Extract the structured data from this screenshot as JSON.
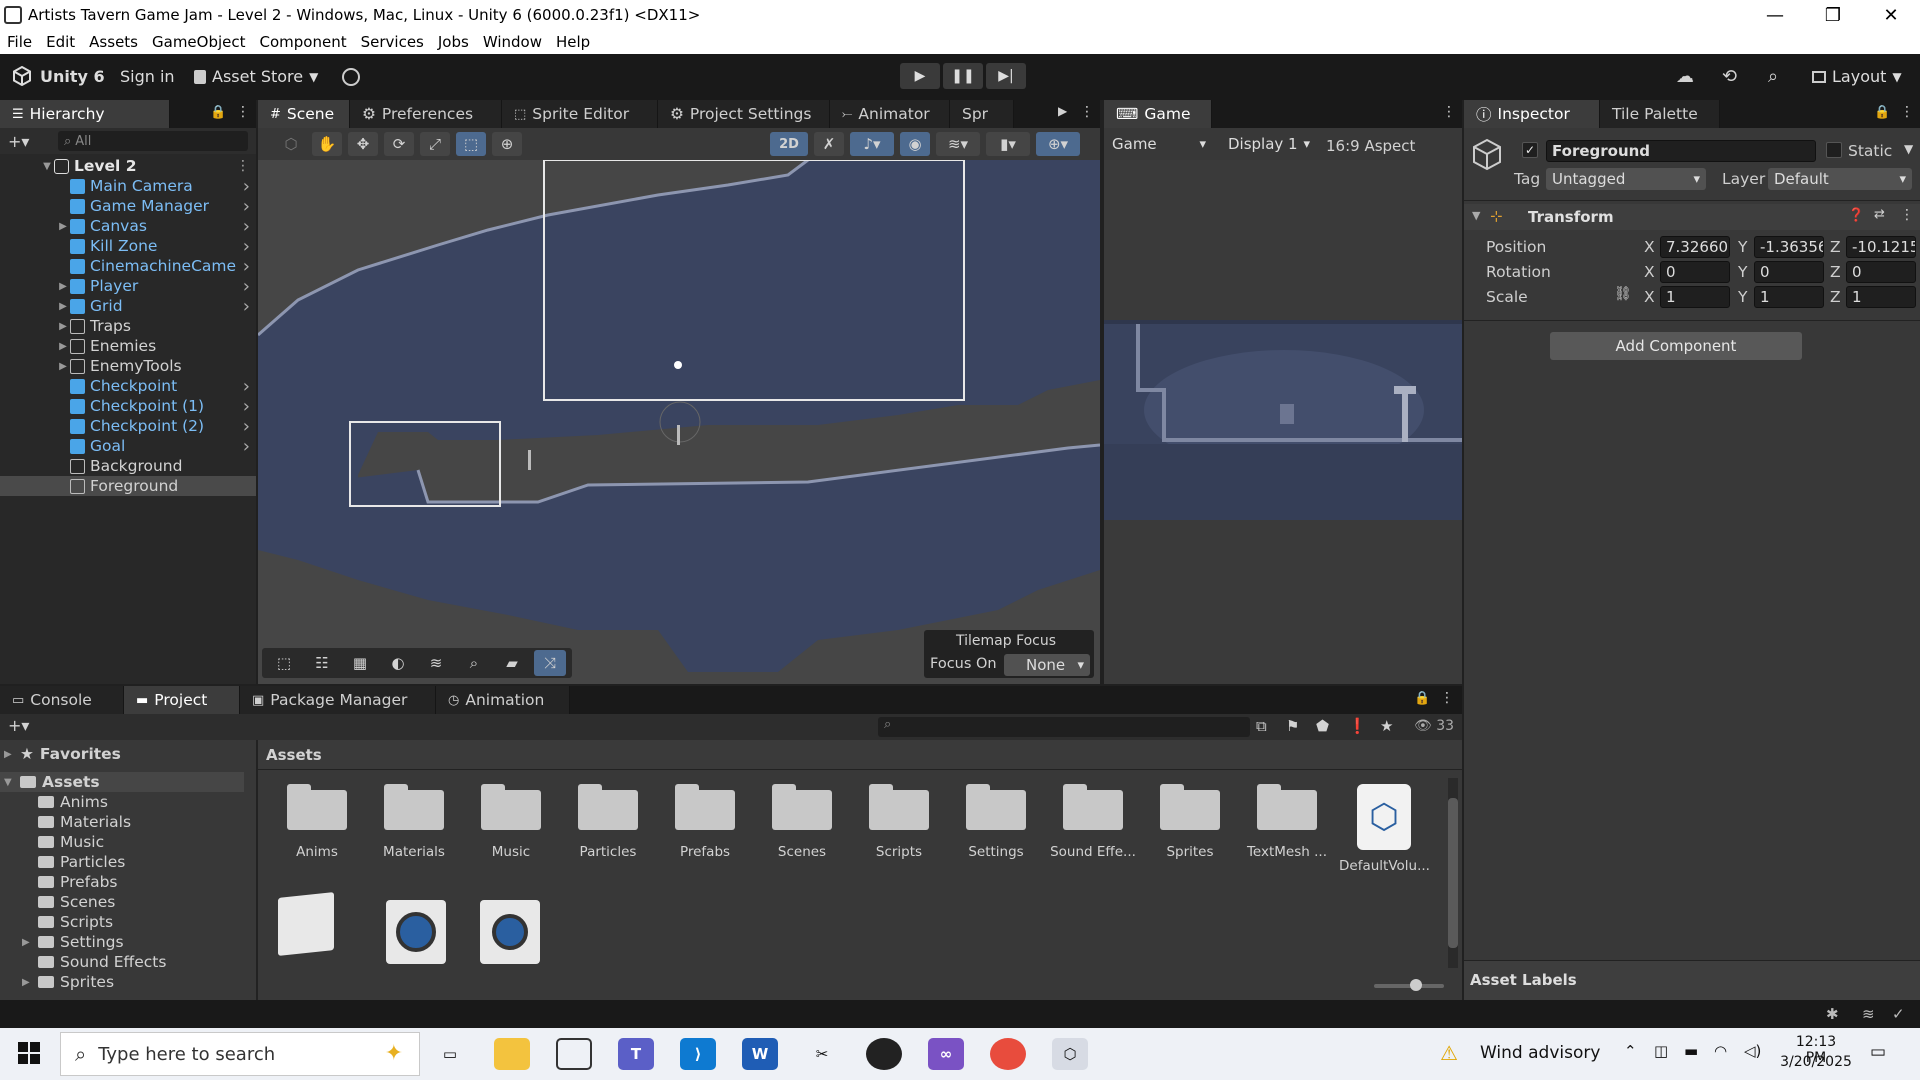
{
  "window": {
    "title": "Artists Tavern Game Jam - Level 2 - Windows, Mac, Linux - Unity 6 (6000.0.23f1) <DX11>",
    "minimize": "—",
    "maximize": "❐",
    "close": "✕"
  },
  "menu": [
    "File",
    "Edit",
    "Assets",
    "GameObject",
    "Component",
    "Services",
    "Jobs",
    "Window",
    "Help"
  ],
  "toolbar": {
    "unity_label": "Unity 6",
    "sign_in": "Sign in",
    "asset_store": "Asset Store",
    "layout": "Layout"
  },
  "hierarchy": {
    "tab": "Hierarchy",
    "search_placeholder": "All",
    "scene": "Level 2",
    "items": [
      {
        "name": "Main Camera",
        "blue": true,
        "expand": false
      },
      {
        "name": "Game Manager",
        "blue": true,
        "expand": false
      },
      {
        "name": "Canvas",
        "blue": true,
        "expand": true
      },
      {
        "name": "Kill Zone",
        "blue": true,
        "expand": false
      },
      {
        "name": "CinemachineCame",
        "blue": true,
        "expand": false
      },
      {
        "name": "Player",
        "blue": true,
        "expand": true
      },
      {
        "name": "Grid",
        "blue": true,
        "expand": true
      },
      {
        "name": "Traps",
        "blue": false,
        "expand": true
      },
      {
        "name": "Enemies",
        "blue": false,
        "expand": true
      },
      {
        "name": "EnemyTools",
        "blue": false,
        "expand": true
      },
      {
        "name": "Checkpoint",
        "blue": true,
        "expand": false
      },
      {
        "name": "Checkpoint (1)",
        "blue": true,
        "expand": false
      },
      {
        "name": "Checkpoint (2)",
        "blue": true,
        "expand": false
      },
      {
        "name": "Goal",
        "blue": true,
        "expand": false
      },
      {
        "name": "Background",
        "blue": false,
        "expand": false
      },
      {
        "name": "Foreground",
        "blue": false,
        "expand": false
      }
    ]
  },
  "center_tabs": [
    "Scene",
    "Preferences",
    "Sprite Editor",
    "Project Settings",
    "Animator",
    "Spr"
  ],
  "scene": {
    "mode_2d": "2D",
    "tilemap_focus": "Tilemap Focus",
    "focus_on": "Focus On",
    "focus_value": "None"
  },
  "game": {
    "tab": "Game",
    "mode": "Game",
    "display": "Display 1",
    "aspect": "16:9 Aspect"
  },
  "inspector": {
    "tabs": [
      "Inspector",
      "Tile Palette"
    ],
    "object_name": "Foreground",
    "static_label": "Static",
    "tag_label": "Tag",
    "tag_value": "Untagged",
    "layer_label": "Layer",
    "layer_value": "Default",
    "component": "Transform",
    "position_label": "Position",
    "rotation_label": "Rotation",
    "scale_label": "Scale",
    "position": {
      "x": "7.32660",
      "y": "-1.36356",
      "z": "-10.1215"
    },
    "rotation": {
      "x": "0",
      "y": "0",
      "z": "0"
    },
    "scale": {
      "x": "1",
      "y": "1",
      "z": "1"
    },
    "add_component": "Add Component",
    "asset_labels": "Asset Labels"
  },
  "bottom_tabs": [
    "Console",
    "Project",
    "Package Manager",
    "Animation"
  ],
  "project": {
    "favorites": "Favorites",
    "assets_root": "Assets",
    "tree": [
      "Anims",
      "Materials",
      "Music",
      "Particles",
      "Prefabs",
      "Scenes",
      "Scripts",
      "Settings",
      "Sound Effects",
      "Sprites"
    ],
    "breadcrumb": "Assets",
    "count": "33",
    "folders": [
      "Anims",
      "Materials",
      "Music",
      "Particles",
      "Prefabs",
      "Scenes",
      "Scripts",
      "Settings",
      "Sound Effe...",
      "Sprites",
      "TextMesh ...",
      "DefaultVolu..."
    ]
  },
  "taskbar": {
    "search_placeholder": "Type here to search",
    "weather": "Wind advisory",
    "time": "12:13 PM",
    "date": "3/20/2025"
  }
}
